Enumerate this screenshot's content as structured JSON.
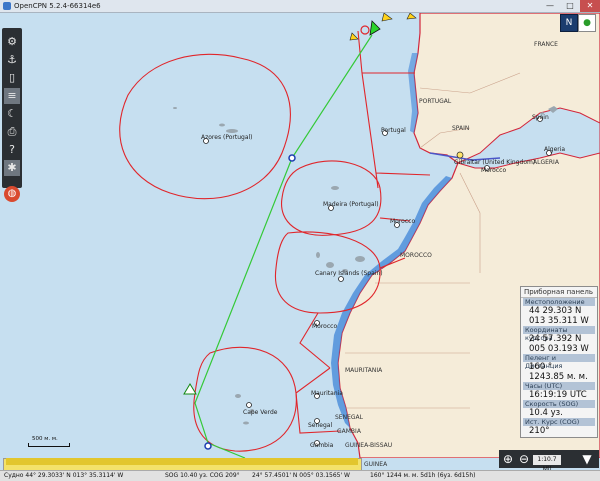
{
  "window": {
    "title": "OpenCPN 5.2.4-66314e6",
    "min_glyph": "—",
    "max_glyph": "□",
    "close_glyph": "✕"
  },
  "toolbar": {
    "items": [
      {
        "name": "settings",
        "glyph": "⚙"
      },
      {
        "name": "route",
        "glyph": "⚓"
      },
      {
        "name": "track",
        "glyph": "▯"
      },
      {
        "name": "layers",
        "glyph": "≡"
      },
      {
        "name": "tides",
        "glyph": "☾"
      },
      {
        "name": "print",
        "glyph": "⎙"
      },
      {
        "name": "help",
        "glyph": "?"
      },
      {
        "name": "ais",
        "glyph": "✱"
      },
      {
        "name": "mob",
        "glyph": "◍"
      }
    ]
  },
  "map": {
    "labels": [
      {
        "text": "Azores (Portugal)"
      },
      {
        "text": "Madeira (Portugal)"
      },
      {
        "text": "Canary Islands (Spain)"
      },
      {
        "text": "Cape Verde"
      },
      {
        "text": "Morocco"
      },
      {
        "text": "Morocco"
      },
      {
        "text": "Mauritania"
      },
      {
        "text": "Senegal"
      },
      {
        "text": "Gambia"
      },
      {
        "text": "Gibraltar (United Kingdom)"
      },
      {
        "text": "Portugal"
      },
      {
        "text": "Spain"
      },
      {
        "text": "Algeria"
      },
      {
        "text": "Morocco"
      }
    ],
    "countries": [
      {
        "text": "FRANCE"
      },
      {
        "text": "PORTUGAL"
      },
      {
        "text": "SPAIN"
      },
      {
        "text": "ALGERIA"
      },
      {
        "text": "MOROCCO"
      },
      {
        "text": "MAURITANIA"
      },
      {
        "text": "SENEGAL"
      },
      {
        "text": "GAMBIA"
      },
      {
        "text": "GUINEA-BISSAU"
      },
      {
        "text": "GUINEA"
      }
    ],
    "scale_label": "500 м. м."
  },
  "dashboard": {
    "title": "Приборная панель",
    "cells": [
      {
        "caption": "Местоположение",
        "lines": [
          "44 29.303 N",
          "013 35.311 W"
        ]
      },
      {
        "caption": "Координаты курсора",
        "lines": [
          "24 57.392 N",
          "005 03.193 W"
        ]
      },
      {
        "caption": "Пеленг и Дистанция",
        "lines": [
          "160 °",
          "1243.85 м. м."
        ]
      },
      {
        "caption": "Часы (UTC)",
        "lines": [
          "16:19:19 UTC"
        ]
      },
      {
        "caption": "Скорость (SOG)",
        "lines": [
          "10.4 уз."
        ]
      },
      {
        "caption": "Ист. Курс (COG)",
        "lines": [
          "210°"
        ]
      }
    ]
  },
  "bottom_toolbar": {
    "zoom_in": "⊕",
    "zoom_out": "⊖",
    "scale_text": "1:10.7 Мil",
    "quilt": "▼"
  },
  "statusbar": {
    "position": "Судно 44° 29.3033' N   013° 35.3114' W",
    "sog_cog": "SOG 10.40 уз.  COG 209°",
    "cursor": "24° 57.4501' N  005° 03.1565' W",
    "bearing": "160°  1244 м. м.  5d1h (6уз.  6d15h)"
  },
  "colors": {
    "zone": "#e0262b",
    "route": "#34c937",
    "land": "#f5ecd9",
    "sea": "#c6dff0",
    "coast": "#3f86d8"
  }
}
